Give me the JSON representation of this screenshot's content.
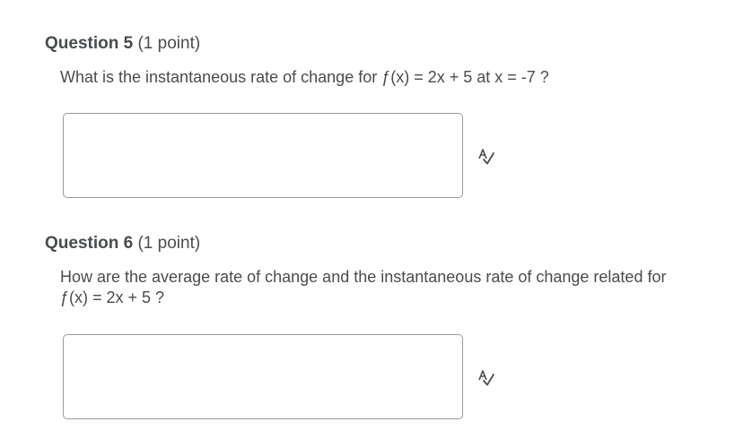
{
  "questions": [
    {
      "number_label": "Question 5",
      "points_label": "(1 point)",
      "text": "What is the instantaneous rate of change for ƒ(x) = 2x + 5 at x = -7 ?",
      "answer_value": "",
      "spellcheck_icon": "spellcheck-icon"
    },
    {
      "number_label": "Question 6",
      "points_label": "(1 point)",
      "text_line1": "How are the average rate of change and the instantaneous rate of change related for",
      "text_line2": "ƒ(x) = 2x + 5 ?",
      "answer_value": "",
      "spellcheck_icon": "spellcheck-icon"
    }
  ]
}
